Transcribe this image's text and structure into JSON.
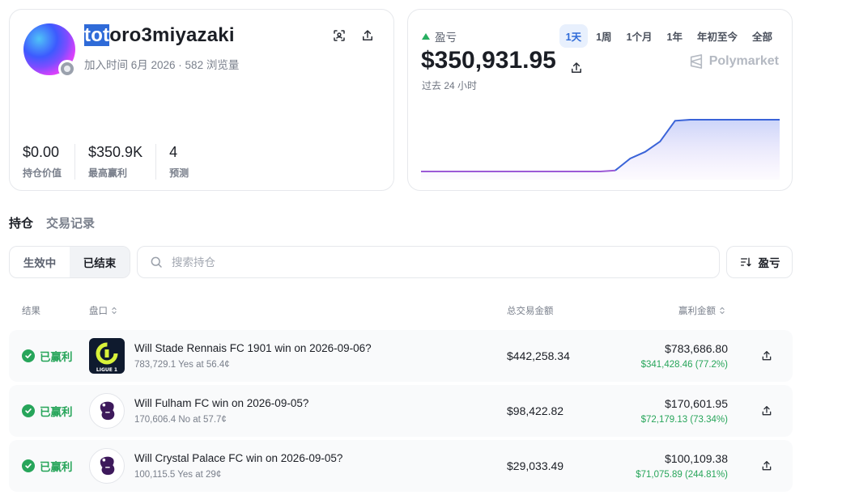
{
  "profile": {
    "username_selected": "tot",
    "username_rest": "oro3miyazaki",
    "joined": "加入时间 6月 2026",
    "views": "582 浏览量",
    "stats": [
      {
        "value": "$0.00",
        "label": "持仓价值"
      },
      {
        "value": "$350.9K",
        "label": "最高赢利"
      },
      {
        "value": "4",
        "label": "预测"
      }
    ]
  },
  "pnl": {
    "label": "盈亏",
    "value": "$350,931.95",
    "subtitle": "过去 24 小时",
    "brand": "Polymarket",
    "ranges": [
      "1天",
      "1周",
      "1个月",
      "1年",
      "年初至今",
      "全部"
    ],
    "active_range": "1天",
    "colors": {
      "before": "#9b59d6",
      "after": "#3a63d8"
    }
  },
  "chart_data": {
    "type": "area",
    "x": [
      0,
      1,
      2,
      3,
      4,
      5,
      6,
      7,
      8,
      9,
      10,
      11,
      12,
      13,
      14,
      15,
      16,
      17,
      18,
      19,
      20,
      21,
      22,
      23,
      24
    ],
    "values": [
      0,
      0,
      0,
      0,
      0,
      0,
      0,
      0,
      0,
      0,
      0,
      0,
      0,
      0,
      0,
      0,
      0,
      0,
      0,
      0,
      0,
      0,
      0,
      0,
      0
    ],
    "shape": [
      0,
      0,
      0,
      0,
      0,
      0,
      0,
      0,
      0,
      0,
      0,
      0,
      0,
      0.02,
      0.25,
      0.38,
      0.58,
      0.98,
      1,
      1,
      1,
      1,
      1,
      1,
      1
    ],
    "title": "",
    "xlabel": "",
    "ylabel": "",
    "grid": false
  },
  "tabs": [
    "持仓",
    "交易记录"
  ],
  "filters": [
    "生效中",
    "已结束"
  ],
  "active_filter": "已结束",
  "search": {
    "placeholder": "搜索持仓"
  },
  "sort": {
    "label": "盈亏"
  },
  "table": {
    "headers": {
      "result": "结果",
      "market": "盘口",
      "volume": "总交易金额",
      "profit": "赢利金额"
    },
    "rows": [
      {
        "status": "已赢利",
        "logo": "ligue1",
        "logo_text": "LIGUE 1",
        "question": "Will Stade Rennais FC 1901 win on 2026-09-06?",
        "sub": "783,729.1 Yes at 56.4¢",
        "volume": "$442,258.34",
        "win": "$783,686.80",
        "profit": "$341,428.46 (77.2%)"
      },
      {
        "status": "已赢利",
        "logo": "premier-league",
        "question": "Will Fulham FC win on 2026-09-05?",
        "sub": "170,606.4 No at 57.7¢",
        "volume": "$98,422.82",
        "win": "$170,601.95",
        "profit": "$72,179.13 (73.34%)"
      },
      {
        "status": "已赢利",
        "logo": "premier-league",
        "question": "Will Crystal Palace FC win on 2026-09-05?",
        "sub": "100,115.5 Yes at 29¢",
        "volume": "$29,033.49",
        "win": "$100,109.38",
        "profit": "$71,075.89 (244.81%)"
      }
    ]
  }
}
